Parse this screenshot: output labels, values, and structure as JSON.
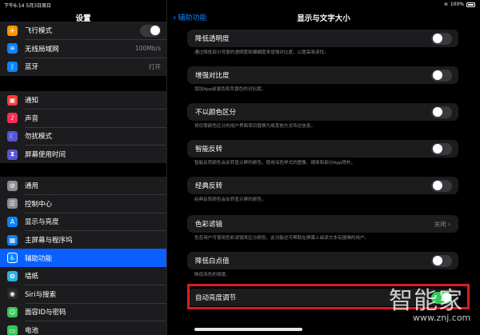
{
  "status_bar": {
    "time": "下午6:14",
    "date": "5月3日周日",
    "battery": "100%"
  },
  "sidebar": {
    "title": "设置",
    "group1": [
      {
        "label": "飞行模式",
        "icon": "airplane-icon",
        "color": "#ff9500",
        "glyph": "✈",
        "toggle": true
      },
      {
        "label": "无线局域网",
        "icon": "wifi-icon",
        "color": "#0a84ff",
        "glyph": "≋",
        "value": "100Mb/s"
      },
      {
        "label": "蓝牙",
        "icon": "bluetooth-icon",
        "color": "#0a84ff",
        "glyph": "ᛒ",
        "value": "打开"
      }
    ],
    "group2": [
      {
        "label": "通知",
        "icon": "notifications-icon",
        "color": "#ff3b30",
        "glyph": "▣"
      },
      {
        "label": "声音",
        "icon": "sound-icon",
        "color": "#ff2d55",
        "glyph": "♪"
      },
      {
        "label": "勿扰模式",
        "icon": "moon-icon",
        "color": "#5856d6",
        "glyph": "☾"
      },
      {
        "label": "屏幕使用时间",
        "icon": "hourglass-icon",
        "color": "#5856d6",
        "glyph": "⧗"
      }
    ],
    "group3": [
      {
        "label": "通用",
        "icon": "gear-icon",
        "color": "#8e8e93",
        "glyph": "⚙"
      },
      {
        "label": "控制中心",
        "icon": "control-center-icon",
        "color": "#8e8e93",
        "glyph": "☰"
      },
      {
        "label": "显示与亮度",
        "icon": "display-brightness-icon",
        "color": "#0a84ff",
        "glyph": "A"
      },
      {
        "label": "主屏幕与程序坞",
        "icon": "home-screen-icon",
        "color": "#0a84ff",
        "glyph": "▦"
      },
      {
        "label": "辅助功能",
        "icon": "accessibility-icon",
        "color": "#0a84ff",
        "glyph": "♿",
        "selected": true
      },
      {
        "label": "墙纸",
        "icon": "wallpaper-icon",
        "color": "#32ade6",
        "glyph": "✿"
      },
      {
        "label": "Siri与搜索",
        "icon": "siri-icon",
        "color": "#2c2c2e",
        "glyph": "◉"
      },
      {
        "label": "面容ID与密码",
        "icon": "face-id-icon",
        "color": "#34c759",
        "glyph": "☺"
      },
      {
        "label": "电池",
        "icon": "battery-icon",
        "color": "#34c759",
        "glyph": "▭"
      }
    ]
  },
  "main": {
    "back_label": "辅助功能",
    "title": "显示与文字大小",
    "settings": [
      {
        "label": "降低透明度",
        "kind": "toggle",
        "on": false,
        "note": "通过降低部分背景的透明度和模糊度来增强对比度，以提高易读性。"
      },
      {
        "label": "增强对比度",
        "kind": "toggle",
        "on": false,
        "note": "增加App前景色和背景色的对比度。"
      },
      {
        "label": "不以颜色区分",
        "kind": "toggle",
        "on": false,
        "note": "将仅靠颜色区分的用户界面项目替换为用其他方式传达信息。"
      },
      {
        "label": "智能反转",
        "kind": "toggle",
        "on": false,
        "note": "智能反转颜色会反转显示屏的颜色，使用深色样式的图像、媒体和部分App除外。"
      },
      {
        "label": "经典反转",
        "kind": "toggle",
        "on": false,
        "note": "经典反转颜色会反转显示屏的颜色。"
      },
      {
        "label": "色彩滤镜",
        "kind": "value",
        "value": "关闭",
        "note": "色盲用户可使用色彩滤镜来区分颜色。此功能还可帮助在屏幕上阅读文本有困难的用户。"
      },
      {
        "label": "降低白点值",
        "kind": "toggle",
        "on": false,
        "note": "降低亮色的强度。"
      },
      {
        "label": "自动亮度调节",
        "kind": "toggle",
        "on": true,
        "note": ""
      }
    ]
  },
  "watermark": {
    "text": "智能家",
    "url": "www.znj.com"
  },
  "colors": {
    "accent": "#0a84ff",
    "toggle_on": "#34c759",
    "highlight": "#d81e1e",
    "selected_row": "#0a60ff"
  }
}
